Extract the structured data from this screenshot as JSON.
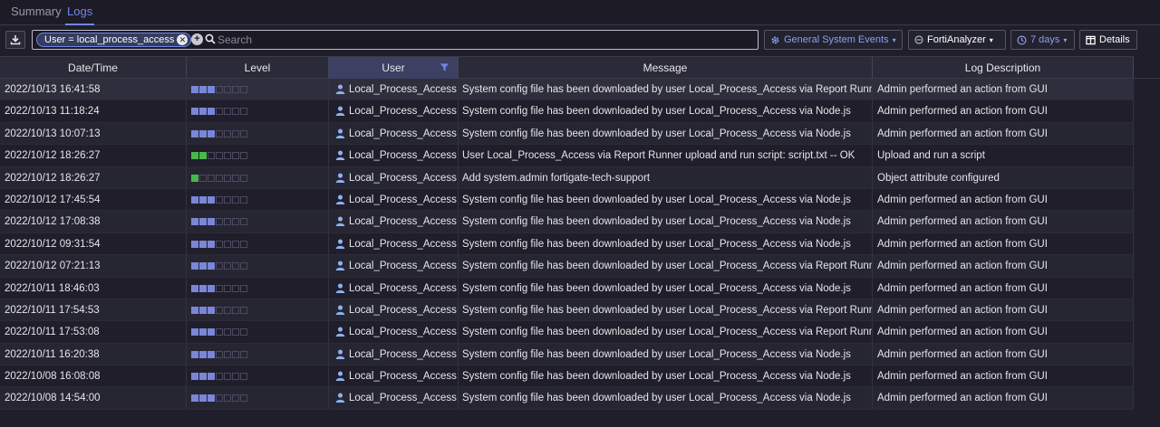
{
  "tabs": [
    {
      "label": "Summary",
      "active": false
    },
    {
      "label": "Logs",
      "active": true
    }
  ],
  "toolbar": {
    "filter_chip": "User = local_process_access",
    "search_placeholder": "Search",
    "event_type": "General System Events",
    "device": "FortiAnalyzer",
    "time_range": "7 days",
    "details": "Details"
  },
  "icons": {
    "download": "download-icon",
    "remove_filter": "close-icon",
    "add_filter": "plus-circle-icon",
    "search": "search-icon",
    "events": "gear-icon",
    "device": "device-icon",
    "time": "clock-icon",
    "details": "panel-icon",
    "filter": "filter-icon",
    "user": "user-icon"
  },
  "colors": {
    "accent": "#6f86e6",
    "level_blue": "#7a86d8",
    "level_green": "#48b84a"
  },
  "table": {
    "columns": [
      "Date/Time",
      "Level",
      "User",
      "Message",
      "Log Description"
    ],
    "rows": [
      {
        "datetime": "2022/10/13 16:41:58",
        "level": 3,
        "level_color": "blue",
        "user": "Local_Process_Access",
        "message": "System config file has been downloaded by user Local_Process_Access via Report Runner",
        "description": "Admin performed an action from GUI"
      },
      {
        "datetime": "2022/10/13 11:18:24",
        "level": 3,
        "level_color": "blue",
        "user": "Local_Process_Access",
        "message": "System config file has been downloaded by user Local_Process_Access via Node.js",
        "description": "Admin performed an action from GUI"
      },
      {
        "datetime": "2022/10/13 10:07:13",
        "level": 3,
        "level_color": "blue",
        "user": "Local_Process_Access",
        "message": "System config file has been downloaded by user Local_Process_Access via Node.js",
        "description": "Admin performed an action from GUI"
      },
      {
        "datetime": "2022/10/12 18:26:27",
        "level": 2,
        "level_color": "green",
        "user": "Local_Process_Access",
        "message": "User Local_Process_Access via Report Runner upload and run script: script.txt -- OK",
        "description": "Upload and run a script"
      },
      {
        "datetime": "2022/10/12 18:26:27",
        "level": 1,
        "level_color": "green",
        "user": "Local_Process_Access",
        "message": "Add system.admin fortigate-tech-support",
        "description": "Object attribute configured"
      },
      {
        "datetime": "2022/10/12 17:45:54",
        "level": 3,
        "level_color": "blue",
        "user": "Local_Process_Access",
        "message": "System config file has been downloaded by user Local_Process_Access via Node.js",
        "description": "Admin performed an action from GUI"
      },
      {
        "datetime": "2022/10/12 17:08:38",
        "level": 3,
        "level_color": "blue",
        "user": "Local_Process_Access",
        "message": "System config file has been downloaded by user Local_Process_Access via Node.js",
        "description": "Admin performed an action from GUI"
      },
      {
        "datetime": "2022/10/12 09:31:54",
        "level": 3,
        "level_color": "blue",
        "user": "Local_Process_Access",
        "message": "System config file has been downloaded by user Local_Process_Access via Node.js",
        "description": "Admin performed an action from GUI"
      },
      {
        "datetime": "2022/10/12 07:21:13",
        "level": 3,
        "level_color": "blue",
        "user": "Local_Process_Access",
        "message": "System config file has been downloaded by user Local_Process_Access via Report Runner",
        "description": "Admin performed an action from GUI"
      },
      {
        "datetime": "2022/10/11 18:46:03",
        "level": 3,
        "level_color": "blue",
        "user": "Local_Process_Access",
        "message": "System config file has been downloaded by user Local_Process_Access via Node.js",
        "description": "Admin performed an action from GUI"
      },
      {
        "datetime": "2022/10/11 17:54:53",
        "level": 3,
        "level_color": "blue",
        "user": "Local_Process_Access",
        "message": "System config file has been downloaded by user Local_Process_Access via Report Runner",
        "description": "Admin performed an action from GUI"
      },
      {
        "datetime": "2022/10/11 17:53:08",
        "level": 3,
        "level_color": "blue",
        "user": "Local_Process_Access",
        "message": "System config file has been downloaded by user Local_Process_Access via Report Runner",
        "description": "Admin performed an action from GUI"
      },
      {
        "datetime": "2022/10/11 16:20:38",
        "level": 3,
        "level_color": "blue",
        "user": "Local_Process_Access",
        "message": "System config file has been downloaded by user Local_Process_Access via Node.js",
        "description": "Admin performed an action from GUI"
      },
      {
        "datetime": "2022/10/08 16:08:08",
        "level": 3,
        "level_color": "blue",
        "user": "Local_Process_Access",
        "message": "System config file has been downloaded by user Local_Process_Access via Node.js",
        "description": "Admin performed an action from GUI"
      },
      {
        "datetime": "2022/10/08 14:54:00",
        "level": 3,
        "level_color": "blue",
        "user": "Local_Process_Access",
        "message": "System config file has been downloaded by user Local_Process_Access via Node.js",
        "description": "Admin performed an action from GUI"
      }
    ]
  }
}
